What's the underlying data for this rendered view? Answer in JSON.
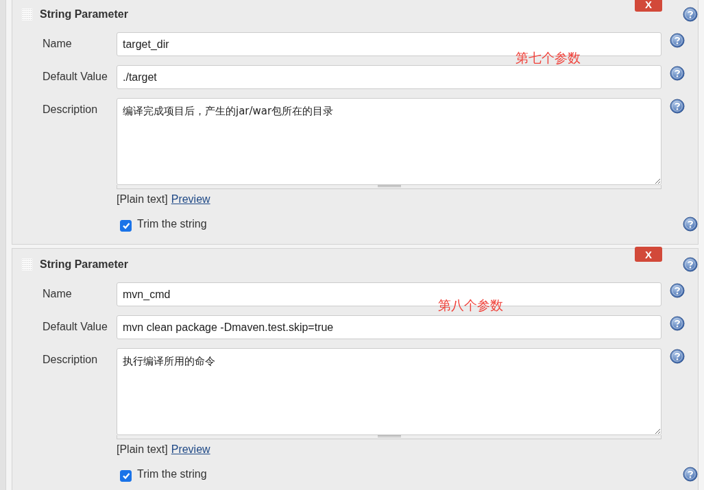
{
  "parameters": [
    {
      "type": "String Parameter",
      "delete_label": "X",
      "annotation": "第七个参数",
      "fields": [
        {
          "kind": "input",
          "label": "Name",
          "value": "target_dir"
        },
        {
          "kind": "input",
          "label": "Default Value",
          "value": "./target"
        },
        {
          "kind": "textarea",
          "label": "Description",
          "value": "编译完成项目后，产生的jar/war包所在的目录"
        }
      ],
      "format": "[Plain text]",
      "preview_link": "Preview",
      "trim": {
        "label": "Trim the string",
        "checked": true
      }
    },
    {
      "type": "String Parameter",
      "delete_label": "X",
      "annotation": "第八个参数",
      "fields": [
        {
          "kind": "input",
          "label": "Name",
          "value": "mvn_cmd"
        },
        {
          "kind": "input",
          "label": "Default Value",
          "value": "mvn clean package -Dmaven.test.skip=true"
        },
        {
          "kind": "textarea",
          "label": "Description",
          "value": "执行编译所用的命令"
        }
      ],
      "format": "[Plain text]",
      "preview_link": "Preview",
      "trim": {
        "label": "Trim the string",
        "checked": true
      }
    }
  ]
}
